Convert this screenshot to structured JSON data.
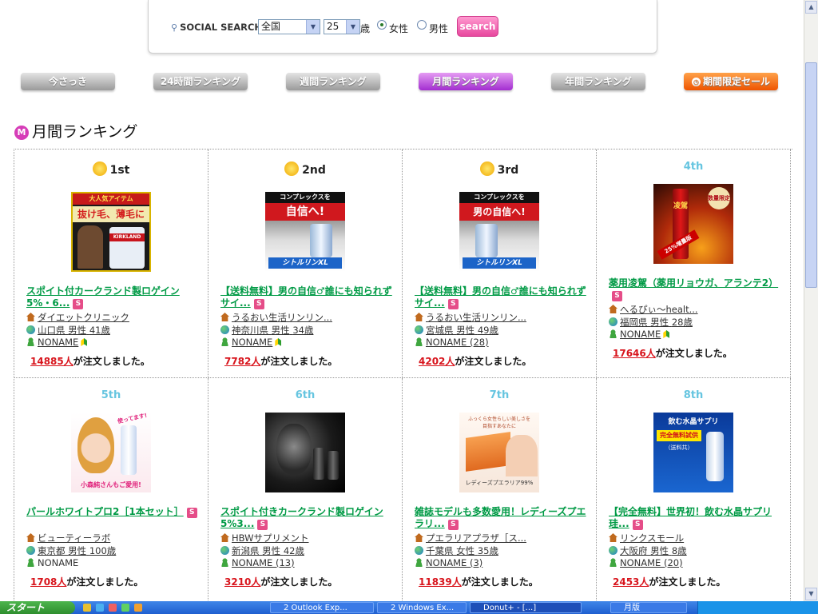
{
  "search": {
    "label": "SOCIAL SEARCH",
    "region": "全国",
    "age": "25",
    "age_unit": "歳",
    "gender_female": "女性",
    "gender_male": "男性",
    "button": "search"
  },
  "tabs": [
    "今さっき",
    "24時間ランキング",
    "週間ランキング",
    "月間ランキング",
    "年間ランキング",
    "期間限定セール"
  ],
  "section_title": "月間ランキング",
  "section_badge": "M",
  "orders_suffix": "が注文しました。",
  "products": [
    {
      "rank": "1st",
      "title": "スポイト付カークランド製ロゲイン5%・6...",
      "shop": "ダイエットクリニック",
      "pref": "山口県",
      "gender": "男性",
      "age": "41歳",
      "user": "NONAME",
      "orders": "14885人",
      "img_text1": "大人気アイテム",
      "img_text2": "抜け毛、薄毛に",
      "img_text3": "KIRKLAND"
    },
    {
      "rank": "2nd",
      "title": "【送料無料】男の自信♂誰にも知られずサイ...",
      "shop": "うるおい生活リンリン...",
      "pref": "神奈川県",
      "gender": "男性",
      "age": "34歳",
      "user": "NONAME",
      "orders": "7782人",
      "img_text1": "コンプレックスを",
      "img_text2": "自信へ!",
      "img_text3": "シトルリンXL"
    },
    {
      "rank": "3rd",
      "title": "【送料無料】男の自信♂誰にも知られずサイ...",
      "shop": "うるおい生活リンリン...",
      "pref": "宮城県",
      "gender": "男性",
      "age": "49歳",
      "user": "NONAME (28)",
      "orders": "4202人",
      "img_text1": "コンプレックスを",
      "img_text2": "男の自信へ!",
      "img_text3": "シトルリンXL"
    },
    {
      "rank": "4th",
      "title": "薬用凌駕（薬用リョウガ、アランテ2）",
      "shop": "へるぴぃ～healt...",
      "pref": "福岡県",
      "gender": "男性",
      "age": "28歳",
      "user": "NONAME",
      "orders": "17646人",
      "img_text1": "凌駕",
      "img_text2": "25%増量版",
      "img_text3": "数量限定"
    },
    {
      "rank": "5th",
      "title": "パールホワイトプロ2［1本セット］",
      "shop": "ビューティーラボ",
      "pref": "東京都",
      "gender": "男性",
      "age": "100歳",
      "user": "NONAME",
      "orders": "1708人",
      "img_text1": "使ってます!",
      "img_text2": "小森純さんもご愛用!",
      "img_text3": ""
    },
    {
      "rank": "6th",
      "title": "スポイト付きカークランド製ロゲイン5%3...",
      "shop": "HBWサプリメント",
      "pref": "新潟県",
      "gender": "男性",
      "age": "42歳",
      "user": "NONAME (13)",
      "orders": "3210人",
      "img_text1": "",
      "img_text2": "",
      "img_text3": ""
    },
    {
      "rank": "7th",
      "title": "雑誌モデルも多数愛用！レディーズプエラリ...",
      "shop": "プエラリアプラザ［ス...",
      "pref": "千葉県",
      "gender": "女性",
      "age": "35歳",
      "user": "NONAME (3)",
      "orders": "11839人",
      "img_text1": "ふっくら女性らしい美しさを",
      "img_text2": "目指すあなたに",
      "img_text3": "レディーズプエラリア99%"
    },
    {
      "rank": "8th",
      "title": "【完全無料】世界初！飲む水晶サプリ珪...",
      "shop": "リンクスモール",
      "pref": "大阪府",
      "gender": "男性",
      "age": "8歳",
      "user": "NONAME (20)",
      "orders": "2453人",
      "img_text1": "飲む水晶サプリ",
      "img_text2": "完全無料試供",
      "img_text3": "（送料共）"
    }
  ],
  "taskbar": {
    "start": "スタート",
    "tasks": [
      "2 Outlook Exp...",
      "2 Windows Ex...",
      "Donut+ - [...]",
      "月版"
    ]
  },
  "colors": {
    "link_green": "#009a45",
    "order_red": "#d8141c",
    "active_tab": "#b93ee0",
    "sale_tab": "#f06a10",
    "rank_blue": "#66c5e0"
  }
}
